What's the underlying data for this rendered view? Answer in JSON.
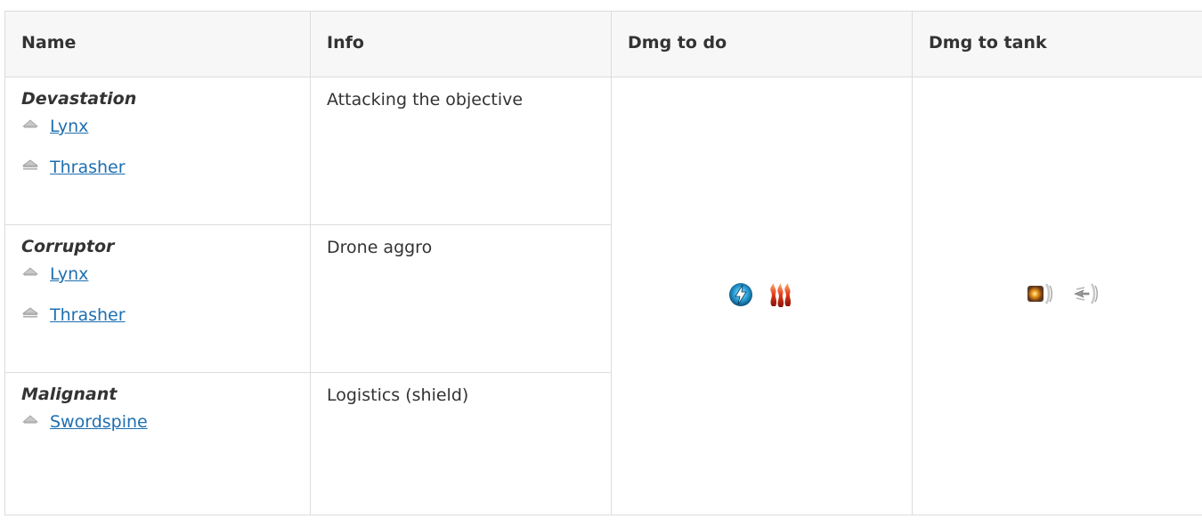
{
  "table": {
    "headers": {
      "name": "Name",
      "info": "Info",
      "dmg_to_do": "Dmg to do",
      "dmg_to_tank": "Dmg to tank"
    },
    "rows": [
      {
        "group": "Devastation",
        "info": "Attacking the objective",
        "ships": [
          {
            "name": "Lynx",
            "icon": "frigate-icon"
          },
          {
            "name": "Thrasher",
            "icon": "destroyer-icon"
          }
        ]
      },
      {
        "group": "Corruptor",
        "info": "Drone aggro",
        "ships": [
          {
            "name": "Lynx",
            "icon": "frigate-icon"
          },
          {
            "name": "Thrasher",
            "icon": "destroyer-icon"
          }
        ]
      },
      {
        "group": "Malignant",
        "info": "Logistics (shield)",
        "ships": [
          {
            "name": "Swordspine",
            "icon": "frigate-icon"
          }
        ]
      }
    ],
    "dmg_to_do_icons": [
      "em-damage-icon",
      "thermal-damage-icon"
    ],
    "dmg_to_tank_icons": [
      "explosive-resist-icon",
      "kinetic-resist-icon"
    ]
  },
  "colors": {
    "link": "#1f6fb0",
    "header_bg": "#f7f7f7",
    "border": "#dcdcdc",
    "text": "#333333"
  }
}
